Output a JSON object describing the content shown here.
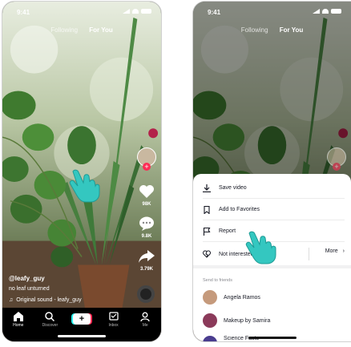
{
  "left_screen": {
    "status_time": "9:41",
    "feed_tabs": [
      "Following",
      "For You"
    ],
    "rail": {
      "likes": "98K",
      "comments": "9.8K",
      "shares": "3.79K"
    },
    "caption": {
      "handle": "@leafy_guy",
      "description": "no leaf unturned",
      "sound": "Original sound - leafy_guy"
    },
    "bottom_nav": [
      "Home",
      "Discover",
      "",
      "Inbox",
      "Me"
    ]
  },
  "right_screen": {
    "status_time": "9:41",
    "feed_tabs": [
      "Following",
      "For You"
    ],
    "sheet": {
      "actions": [
        "Save video",
        "Add to Favorites",
        "Report",
        "Not interested"
      ],
      "more_label": "More",
      "section_label": "Send to friends",
      "friends": [
        "Angela Ramos",
        "Makeup by Samira",
        "Science Facts"
      ]
    }
  },
  "colors": {
    "accent_red": "#fe2c55",
    "accent_cyan": "#25f4ee",
    "sheet_bg": "#ffffff",
    "hand_fill": "#34c7c0"
  },
  "icons": [
    "hand-pointer-icon",
    "heart-icon",
    "comment-icon",
    "share-icon",
    "music-note-icon",
    "download-icon",
    "bookmark-icon",
    "flag-icon",
    "broken-heart-icon",
    "chevron-right-icon"
  ]
}
